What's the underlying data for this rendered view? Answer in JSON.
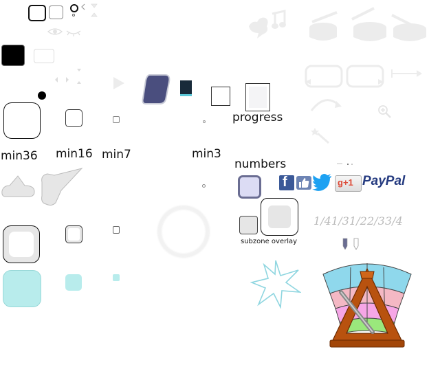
{
  "labels": {
    "progress": "progress",
    "numbers": "numbers",
    "min36": "min36",
    "min16": "min16",
    "min7": "min7",
    "min3": "min3",
    "subzone_overlay": "subzone overlay"
  },
  "fractions": [
    "1/4",
    "1/3",
    "1/2",
    "2/3",
    "3/4"
  ],
  "social": {
    "facebook": "f",
    "gplus": "g+1",
    "paypal": "PayPal"
  },
  "colors": {
    "accent_navy": "#4a4e7e",
    "cyan_light": "#b8ecec",
    "icon_gray": "#e4e4e4",
    "paypal_dark": "#253b80",
    "paypal_light": "#179bd7",
    "gplus_red": "#dd4b39",
    "facebook_blue": "#3b5998",
    "twitter_blue": "#1da1f2",
    "metronome_orange": "#b8520f"
  }
}
